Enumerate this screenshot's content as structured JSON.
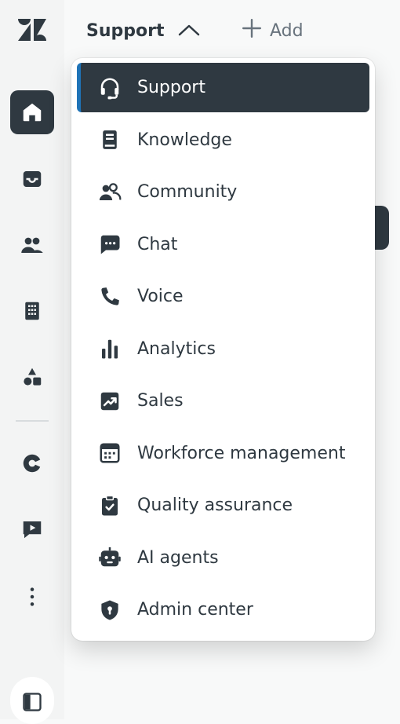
{
  "topbar": {
    "product_label": "Support",
    "add_label": "Add"
  },
  "rail": {
    "items": [
      {
        "icon": "home-icon",
        "active": true
      },
      {
        "icon": "inbox-icon",
        "active": false
      },
      {
        "icon": "users-icon",
        "active": false
      },
      {
        "icon": "building-icon",
        "active": false
      },
      {
        "icon": "shapes-icon",
        "active": false
      },
      {
        "icon": "pie-chart-icon",
        "active": false
      },
      {
        "icon": "chat-play-icon",
        "active": false
      },
      {
        "icon": "more-vertical-icon",
        "active": false
      }
    ],
    "bottom_icon": "sidebar-toggle-icon"
  },
  "menu": {
    "items": [
      {
        "label": "Support",
        "icon": "headset-icon",
        "selected": true
      },
      {
        "label": "Knowledge",
        "icon": "book-icon",
        "selected": false
      },
      {
        "label": "Community",
        "icon": "community-icon",
        "selected": false
      },
      {
        "label": "Chat",
        "icon": "chat-icon",
        "selected": false
      },
      {
        "label": "Voice",
        "icon": "phone-icon",
        "selected": false
      },
      {
        "label": "Analytics",
        "icon": "bar-chart-icon",
        "selected": false
      },
      {
        "label": "Sales",
        "icon": "trend-icon",
        "selected": false
      },
      {
        "label": "Workforce management",
        "icon": "calendar-icon",
        "selected": false
      },
      {
        "label": "Quality assurance",
        "icon": "clipboard-check-icon",
        "selected": false
      },
      {
        "label": "AI agents",
        "icon": "robot-icon",
        "selected": false
      },
      {
        "label": "Admin center",
        "icon": "shield-icon",
        "selected": false
      }
    ]
  },
  "colors": {
    "dark": "#2f3941",
    "accent": "#1f73b7",
    "muted": "#68737d"
  }
}
